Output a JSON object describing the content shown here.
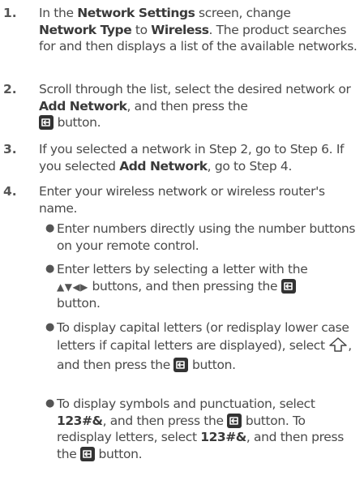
{
  "steps": [
    {
      "number": "1.",
      "parts": [
        "In the ",
        "Network Settings",
        " screen, change ",
        "Network Type",
        " to ",
        "Wireless",
        ". The product searches for and then displays a list of the available networks."
      ]
    },
    {
      "number": "2.",
      "parts": [
        "Scroll through the list, select the desired network or ",
        "Add Network",
        ", and then press the ",
        " button."
      ]
    },
    {
      "number": "3.",
      "parts": [
        "If you selected a network in Step 2, go to Step 6. If you selected ",
        "Add Network",
        ", go to Step 4."
      ]
    },
    {
      "number": "4.",
      "parts": [
        "Enter your wireless network or wireless router's name."
      ]
    }
  ],
  "bullets": [
    {
      "parts": [
        "Enter numbers directly using the number buttons on your remote control."
      ]
    },
    {
      "parts": [
        "Enter letters by selecting a letter with the ",
        "▲▼◀▶",
        " buttons, and then pressing the ",
        " button."
      ]
    },
    {
      "parts": [
        "To display capital letters (or redisplay lower case letters if capital letters are displayed), select ",
        ", and then press the ",
        " button."
      ]
    },
    {
      "parts": [
        "To display symbols and punctuation, select ",
        "123#&",
        ", and then press the ",
        " button. To redisplay letters, select ",
        "123#&",
        ", and then press the ",
        " button."
      ]
    }
  ],
  "icons": {
    "enter": "enter-button-icon",
    "arrows": "arrow-buttons-icon",
    "caps": "caps-arrow-icon"
  },
  "colors": {
    "text": "#4a4a4a",
    "icon_bg": "#333333"
  }
}
